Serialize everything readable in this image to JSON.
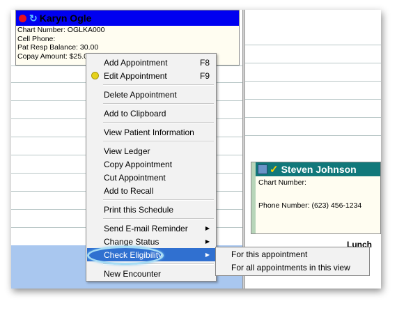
{
  "appointment_1": {
    "patient_name": "Karyn Ogle",
    "lines": [
      "Chart Number: OGLKA000",
      "Cell Phone:",
      "Pat Resp Balance: 30.00",
      "Copay Amount: $25.00"
    ],
    "status_icon": "red-dot-icon",
    "sync_icon": "sync-icon"
  },
  "appointment_2": {
    "patient_name": "Steven Johnson",
    "chart_number": "Chart Number:",
    "phone": "Phone Number: (623) 456-1234",
    "icons": [
      "insurance-card-icon",
      "eligibility-check-icon"
    ]
  },
  "lunch_label": "Lunch",
  "context_menu": {
    "items": [
      {
        "label": "Add Appointment",
        "shortcut": "F8"
      },
      {
        "label": "Edit Appointment",
        "shortcut": "F9"
      },
      {
        "label": "Delete Appointment"
      },
      {
        "label": "Add to Clipboard"
      },
      {
        "label": "View Patient Information"
      },
      {
        "label": "View Ledger"
      },
      {
        "label": "Copy Appointment"
      },
      {
        "label": "Cut Appointment"
      },
      {
        "label": "Add to Recall"
      },
      {
        "label": "Print this Schedule"
      },
      {
        "label": "Send E-mail Reminder"
      },
      {
        "label": "Change Status"
      },
      {
        "label": "Check Eligibility"
      },
      {
        "label": "New Encounter"
      }
    ]
  },
  "submenu": {
    "items": [
      "For this appointment",
      "For all appointments in this view"
    ]
  },
  "colors": {
    "highlight": "#3070d0",
    "appt1_header": "#0000f0",
    "appt2_header": "#11787a"
  }
}
